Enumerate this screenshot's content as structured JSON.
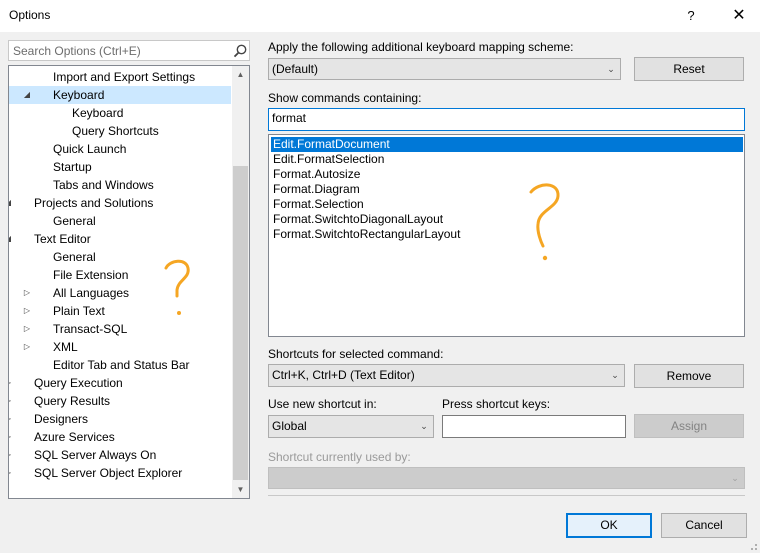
{
  "window": {
    "title": "Options",
    "help_label": "?",
    "close_label": "✕"
  },
  "search": {
    "placeholder": "Search Options (Ctrl+E)",
    "value": ""
  },
  "tree": {
    "items": [
      {
        "label": "Import and Export Settings",
        "indent": 2,
        "expander": "none",
        "selected": false
      },
      {
        "label": "Keyboard",
        "indent": 2,
        "expander": "expanded",
        "selected": true
      },
      {
        "label": "Keyboard",
        "indent": 3,
        "expander": "none",
        "selected": false
      },
      {
        "label": "Query Shortcuts",
        "indent": 3,
        "expander": "none",
        "selected": false
      },
      {
        "label": "Quick Launch",
        "indent": 2,
        "expander": "none",
        "selected": false
      },
      {
        "label": "Startup",
        "indent": 2,
        "expander": "none",
        "selected": false
      },
      {
        "label": "Tabs and Windows",
        "indent": 2,
        "expander": "none",
        "selected": false
      },
      {
        "label": "Projects and Solutions",
        "indent": 1,
        "expander": "expanded",
        "selected": false
      },
      {
        "label": "General",
        "indent": 2,
        "expander": "none",
        "selected": false
      },
      {
        "label": "Text Editor",
        "indent": 1,
        "expander": "expanded",
        "selected": false
      },
      {
        "label": "General",
        "indent": 2,
        "expander": "none",
        "selected": false
      },
      {
        "label": "File Extension",
        "indent": 2,
        "expander": "none",
        "selected": false
      },
      {
        "label": "All Languages",
        "indent": 2,
        "expander": "collapsed",
        "selected": false
      },
      {
        "label": "Plain Text",
        "indent": 2,
        "expander": "collapsed",
        "selected": false
      },
      {
        "label": "Transact-SQL",
        "indent": 2,
        "expander": "collapsed",
        "selected": false
      },
      {
        "label": "XML",
        "indent": 2,
        "expander": "collapsed",
        "selected": false
      },
      {
        "label": "Editor Tab and Status Bar",
        "indent": 2,
        "expander": "none",
        "selected": false
      },
      {
        "label": "Query Execution",
        "indent": 1,
        "expander": "collapsed",
        "selected": false
      },
      {
        "label": "Query Results",
        "indent": 1,
        "expander": "collapsed",
        "selected": false
      },
      {
        "label": "Designers",
        "indent": 1,
        "expander": "collapsed",
        "selected": false
      },
      {
        "label": "Azure Services",
        "indent": 1,
        "expander": "collapsed",
        "selected": false
      },
      {
        "label": "SQL Server Always On",
        "indent": 1,
        "expander": "collapsed",
        "selected": false
      },
      {
        "label": "SQL Server Object Explorer",
        "indent": 1,
        "expander": "collapsed",
        "selected": false
      }
    ]
  },
  "mapping": {
    "label": "Apply the following additional keyboard mapping scheme:",
    "value": "(Default)",
    "reset_label": "Reset"
  },
  "show_commands": {
    "label": "Show commands containing:",
    "value": "format"
  },
  "commands": [
    {
      "label": "Edit.FormatDocument",
      "selected": true
    },
    {
      "label": "Edit.FormatSelection",
      "selected": false
    },
    {
      "label": "Format.Autosize",
      "selected": false
    },
    {
      "label": "Format.Diagram",
      "selected": false
    },
    {
      "label": "Format.Selection",
      "selected": false
    },
    {
      "label": "Format.SwitchtoDiagonalLayout",
      "selected": false
    },
    {
      "label": "Format.SwitchtoRectangularLayout",
      "selected": false
    }
  ],
  "shortcuts": {
    "label": "Shortcuts for selected command:",
    "value": "Ctrl+K, Ctrl+D (Text Editor)",
    "remove_label": "Remove"
  },
  "use_new": {
    "label": "Use new shortcut in:",
    "value": "Global"
  },
  "press_keys": {
    "label": "Press shortcut keys:",
    "value": "",
    "assign_label": "Assign"
  },
  "currently_used": {
    "label": "Shortcut currently used by:",
    "value": ""
  },
  "footer": {
    "ok_label": "OK",
    "cancel_label": "Cancel"
  },
  "colors": {
    "selection": "#0078d7",
    "tree_selection": "#cce8ff",
    "annotation": "#f5a623"
  }
}
